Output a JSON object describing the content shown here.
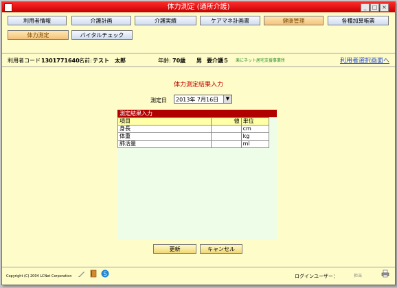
{
  "window": {
    "title": "体力測定 (通所介護)"
  },
  "colors": {
    "accent": "#c00000",
    "background": "#fefcc9",
    "link": "#2a4fd0"
  },
  "nav": {
    "items": [
      {
        "label": "利用者情報",
        "active": false
      },
      {
        "label": "介護計画",
        "active": false
      },
      {
        "label": "介護実績",
        "active": false
      },
      {
        "label": "ケアマネ計画書",
        "active": false
      },
      {
        "label": "健康管理",
        "active": true
      },
      {
        "label": "各種加算帳票",
        "active": false
      }
    ]
  },
  "subnav": {
    "items": [
      {
        "label": "体力測定",
        "active": true
      },
      {
        "label": "バイタルチェック",
        "active": false
      }
    ]
  },
  "user": {
    "code_label": "利用者コード :",
    "code": "1301771640",
    "name_label": "名前:",
    "name": "テスト　太郎",
    "age_label": "年齢:",
    "age": "70歳",
    "gender": "男",
    "care_level": "要介護５",
    "office": "楽にネット居宅支援事業所",
    "select_link": "利用者選択画面へ"
  },
  "page": {
    "title": "体力測定結果入力"
  },
  "date": {
    "label": "測定日",
    "value": "2013年  7月16日"
  },
  "results": {
    "header": "測定結果入力",
    "columns": {
      "item": "項目",
      "value": "値",
      "unit": "単位"
    },
    "rows": [
      {
        "item": "身長",
        "value": "",
        "unit": "cm"
      },
      {
        "item": "体重",
        "value": "",
        "unit": "kg"
      },
      {
        "item": "肺活量",
        "value": "",
        "unit": "ml"
      }
    ]
  },
  "buttons": {
    "update": "更新",
    "cancel": "キャンセル"
  },
  "footer": {
    "copyright": "Copyright (C) 2004 LCNet Corporation",
    "login_label": "ログインユーザー：",
    "login_value": "担当"
  }
}
